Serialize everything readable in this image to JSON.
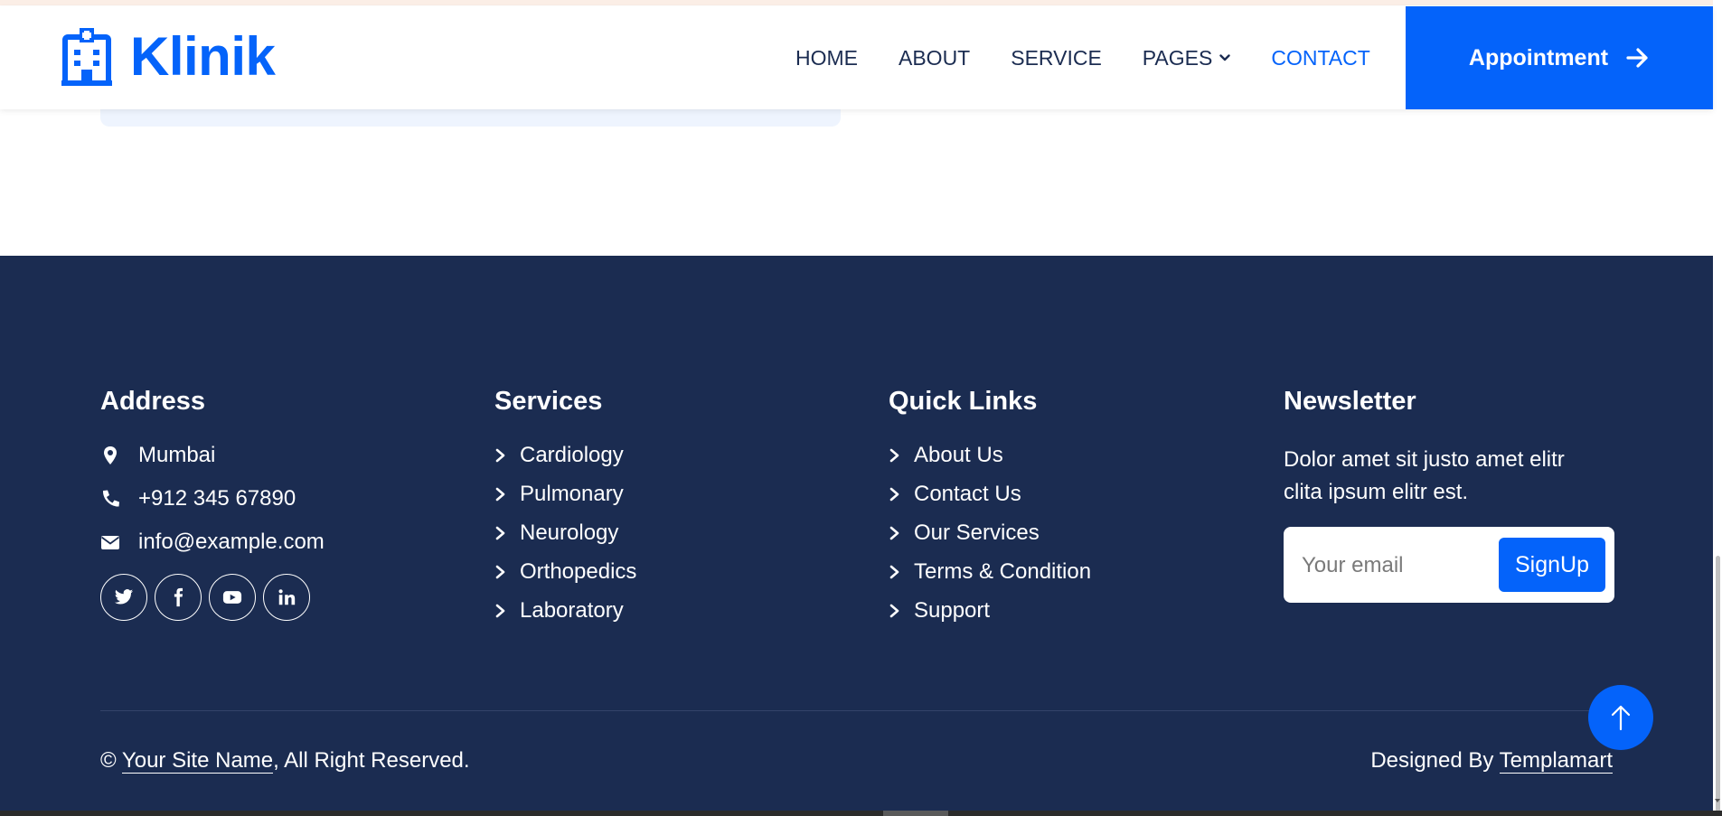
{
  "brand": {
    "name": "Klinik",
    "color": "#0463fa"
  },
  "nav": {
    "items": [
      {
        "label": "HOME",
        "active": false
      },
      {
        "label": "ABOUT",
        "active": false
      },
      {
        "label": "SERVICE",
        "active": false
      },
      {
        "label": "PAGES",
        "active": false,
        "dropdown": true
      },
      {
        "label": "CONTACT",
        "active": true
      }
    ],
    "appointment_label": "Appointment"
  },
  "footer": {
    "background": "#1b2c51",
    "address": {
      "title": "Address",
      "location": "Mumbai",
      "phone": "+912 345 67890",
      "email": "info@example.com",
      "social_icons": [
        "twitter-icon",
        "facebook-icon",
        "youtube-icon",
        "linkedin-icon"
      ]
    },
    "services": {
      "title": "Services",
      "items": [
        "Cardiology",
        "Pulmonary",
        "Neurology",
        "Orthopedics",
        "Laboratory"
      ]
    },
    "quick_links": {
      "title": "Quick Links",
      "items": [
        "About Us",
        "Contact Us",
        "Our Services",
        "Terms & Condition",
        "Support"
      ]
    },
    "newsletter": {
      "title": "Newsletter",
      "text": "Dolor amet sit justo amet elitr clita ipsum elitr est.",
      "placeholder": "Your email",
      "button_label": "SignUp"
    },
    "copyright": {
      "prefix": "©",
      "site_name": "Your Site Name",
      "suffix": ", All Right Reserved."
    },
    "designed": {
      "prefix": "Designed By",
      "author": "Templamart"
    }
  }
}
